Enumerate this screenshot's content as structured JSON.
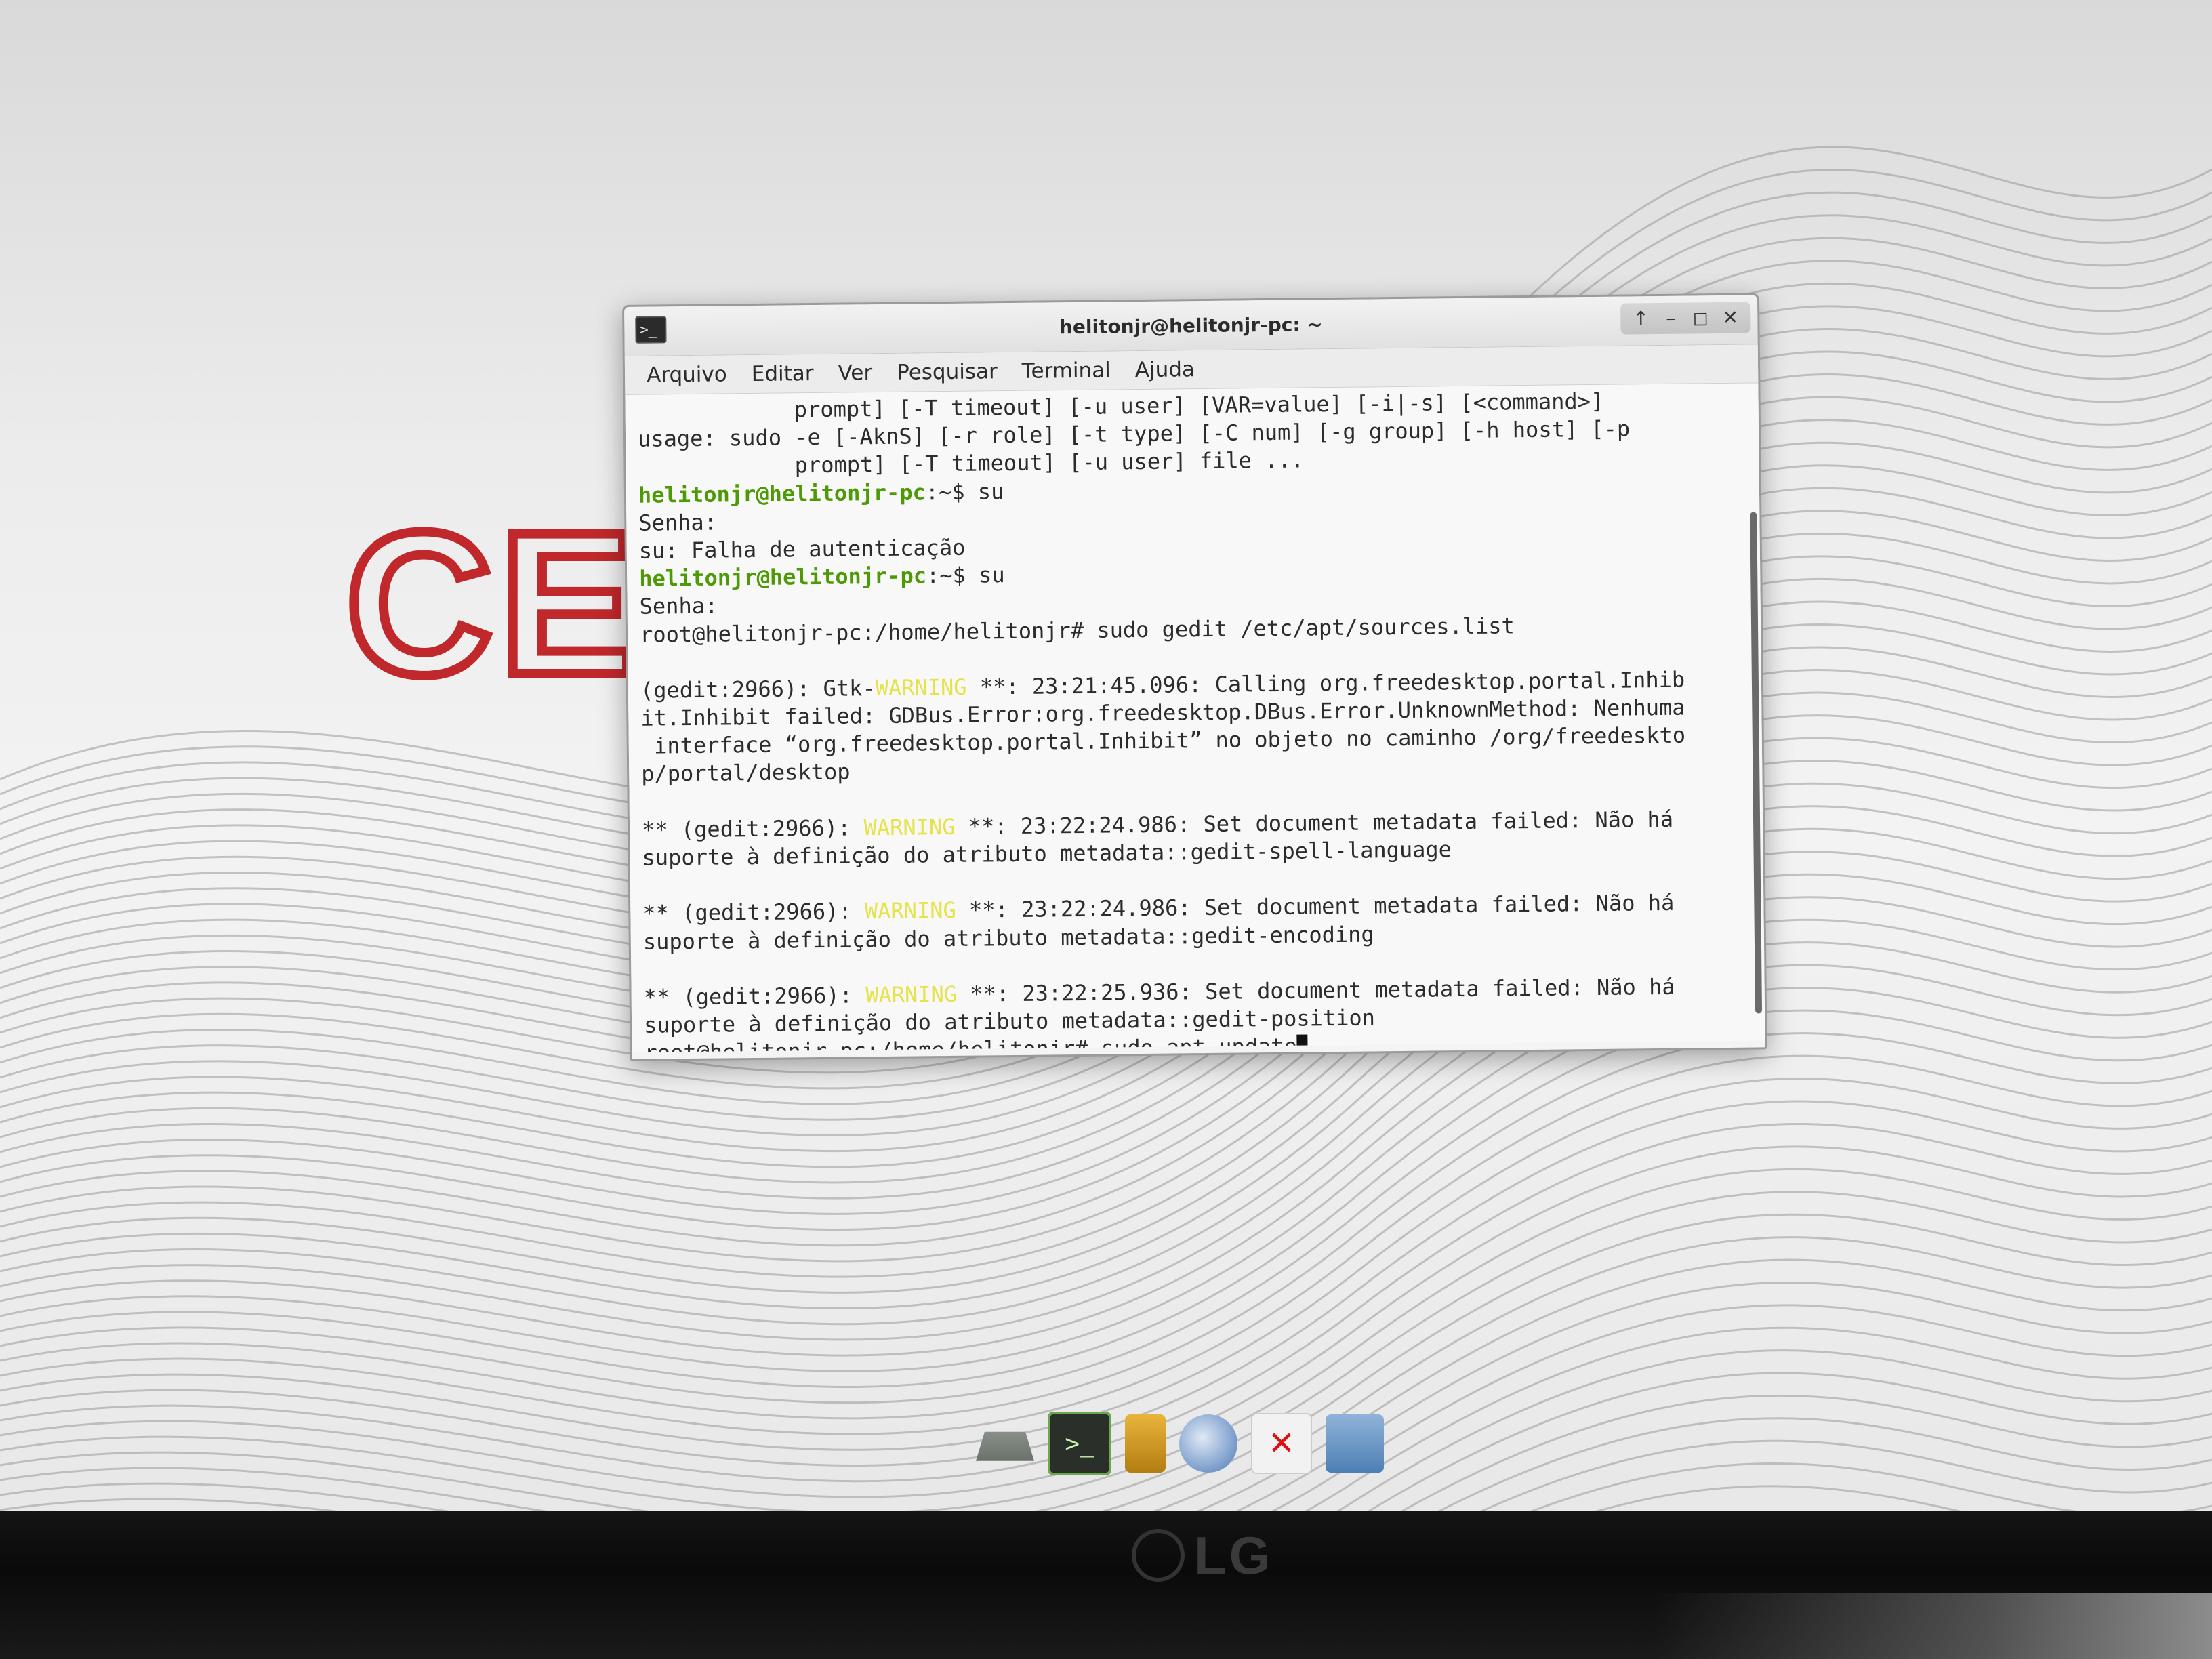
{
  "window": {
    "title": "helitonjr@helitonjr-pc: ~",
    "buttons": [
      "↑",
      "–",
      "◻",
      "✕"
    ]
  },
  "menubar": [
    "Arquivo",
    "Editar",
    "Ver",
    "Pesquisar",
    "Terminal",
    "Ajuda"
  ],
  "terminal": {
    "lines": [
      {
        "text": "            prompt] [-T timeout] [-u user] [VAR=value] [-i|-s] [<command>]"
      },
      {
        "text": "usage: sudo -e [-AknS] [-r role] [-t type] [-C num] [-g group] [-h host] [-p"
      },
      {
        "text": "            prompt] [-T timeout] [-u user] file ..."
      },
      {
        "prompt": "helitonjr@helitonjr-pc",
        "path": ":~$",
        "cmd": " su"
      },
      {
        "text": "Senha:"
      },
      {
        "text": "su: Falha de autenticação"
      },
      {
        "prompt": "helitonjr@helitonjr-pc",
        "path": ":~$",
        "cmd": " su"
      },
      {
        "text": "Senha:"
      },
      {
        "text": "root@helitonjr-pc:/home/helitonjr# sudo gedit /etc/apt/sources.list"
      },
      {
        "text": ""
      },
      {
        "pre": "(gedit:2966): Gtk-",
        "warn": "WARNING",
        "post": " **: 23:21:45.096: Calling org.freedesktop.portal.Inhib"
      },
      {
        "text": "it.Inhibit failed: GDBus.Error:org.freedesktop.DBus.Error.UnknownMethod: Nenhuma"
      },
      {
        "text": " interface “org.freedesktop.portal.Inhibit” no objeto no caminho /org/freedeskto"
      },
      {
        "text": "p/portal/desktop"
      },
      {
        "text": ""
      },
      {
        "pre": "** (gedit:2966): ",
        "warn": "WARNING",
        "post": " **: 23:22:24.986: Set document metadata failed: Não há"
      },
      {
        "text": "suporte à definição do atributo metadata::gedit-spell-language"
      },
      {
        "text": ""
      },
      {
        "pre": "** (gedit:2966): ",
        "warn": "WARNING",
        "post": " **: 23:22:24.986: Set document metadata failed: Não há"
      },
      {
        "text": "suporte à definição do atributo metadata::gedit-encoding"
      },
      {
        "text": ""
      },
      {
        "pre": "** (gedit:2966): ",
        "warn": "WARNING",
        "post": " **: 23:22:25.936: Set document metadata failed: Não há"
      },
      {
        "text": "suporte à definição do atributo metadata::gedit-position"
      },
      {
        "text": "root@helitonjr-pc:/home/helitonjr# sudo apt update",
        "cursor": true
      }
    ]
  },
  "wallpaper": {
    "logo": "CE",
    "logo_color": "#c0282b"
  },
  "dock": {
    "items": [
      {
        "name": "drive-icon"
      },
      {
        "name": "terminal-icon",
        "glyph": ">_"
      },
      {
        "name": "sd-card-icon"
      },
      {
        "name": "browser-globe-icon"
      },
      {
        "name": "close-app-icon",
        "glyph": "✕"
      },
      {
        "name": "folder-icon"
      }
    ]
  },
  "monitor": {
    "brand": "LG"
  },
  "colors": {
    "prompt_green": "#4e9a06",
    "warning_yellow": "#e6e24a"
  }
}
